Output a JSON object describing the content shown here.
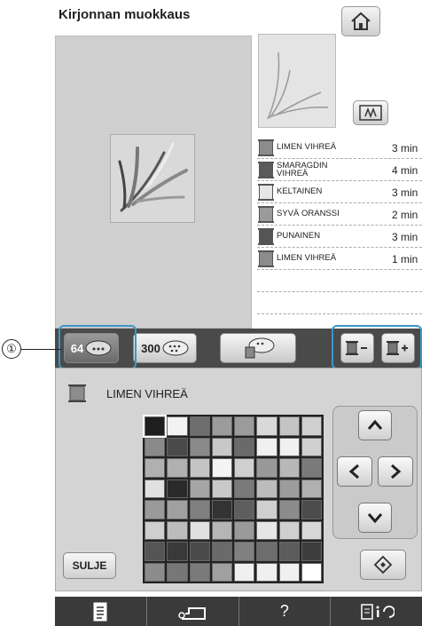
{
  "header": {
    "title": "Kirjonnan muokkaus",
    "home_icon": "home-icon"
  },
  "thumbnail": {
    "frame_icon": "frame-icon"
  },
  "thread_list": [
    {
      "name": "LIMEN VIHREÄ",
      "time": "3 min",
      "color": "#8c8c8c"
    },
    {
      "name": "SMARAGDIN VIHREÄ",
      "time": "4 min",
      "color": "#5a5a5a"
    },
    {
      "name": "KELTAINEN",
      "time": "3 min",
      "color": "#e6e6e6"
    },
    {
      "name": "SYVÄ ORANSSI",
      "time": "2 min",
      "color": "#9a9a9a"
    },
    {
      "name": "PUNAINEN",
      "time": "3 min",
      "color": "#555555"
    },
    {
      "name": "LIMEN VIHREÄ",
      "time": "1 min",
      "color": "#8c8c8c"
    }
  ],
  "toolbar": {
    "palette64": "64",
    "palette300": "300",
    "callout": "①"
  },
  "color_panel": {
    "current_name": "LIMEN VIHREÄ",
    "close_label": "SULJE",
    "palette": [
      [
        "#1e1e1e",
        "#f2f2f2",
        "#6e6e6e",
        "#9b9b9b",
        "#9b9b9b",
        "#d9d9d9",
        "#c4c4c4",
        "#d0d0d0"
      ],
      [
        "#8a8a8a",
        "#4a4a4a",
        "#8a8a8a",
        "#c8c8c8",
        "#6a6a6a",
        "#f0f0f0",
        "#f0f0f0",
        "#cfcfcf"
      ],
      [
        "#b0b0b0",
        "#b0b0b0",
        "#c4c4c4",
        "#f4f4f4",
        "#cfcfcf",
        "#999999",
        "#b8b8b8",
        "#7a7a7a"
      ],
      [
        "#e0e0e0",
        "#2a2a2a",
        "#a5a5a5",
        "#c9c9c9",
        "#7a7a7a",
        "#bcbcbc",
        "#9c9c9c",
        "#b0b0b0"
      ],
      [
        "#9a9a9a",
        "#a0a0a0",
        "#808080",
        "#333333",
        "#5e5e5e",
        "#cfcfcf",
        "#8c8c8c",
        "#4c4c4c"
      ],
      [
        "#cfcfcf",
        "#bcbcbc",
        "#e0e0e0",
        "#b5b5b5",
        "#9a9a9a",
        "#e6e6e6",
        "#cfcfcf",
        "#d8d8d8"
      ],
      [
        "#555555",
        "#3a3a3a",
        "#4a4a4a",
        "#6a6a6a",
        "#808080",
        "#6e6e6e",
        "#5c5c5c",
        "#3e3e3e"
      ],
      [
        "#8c8c8c",
        "#777777",
        "#7a7a7a",
        "#a0a0a0",
        "#f0f0f0",
        "#f0f0f0",
        "#f0f0f0",
        "#ffffff"
      ]
    ]
  },
  "bottom_bar": {
    "help": "?"
  }
}
